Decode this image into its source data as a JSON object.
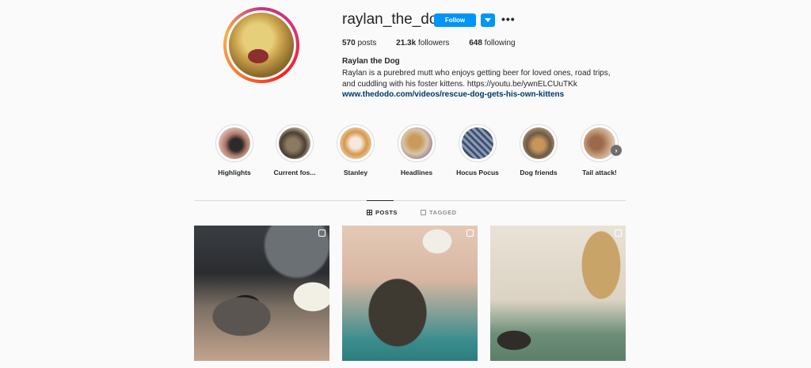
{
  "profile": {
    "username": "raylan_the_dog",
    "follow_label": "Follow",
    "more_glyph": "•••",
    "stats": {
      "posts_count": "570",
      "posts_label": "posts",
      "followers_count": "21.3k",
      "followers_label": "followers",
      "following_count": "648",
      "following_label": "following"
    },
    "full_name": "Raylan the Dog",
    "bio": "Raylan is a purebred mutt who enjoys getting beer for loved ones, road trips, and cuddling with his foster kittens. https://youtu.be/ywnELCUuTKk",
    "link": "www.thedodo.com/videos/rescue-dog-gets-his-own-kittens"
  },
  "highlights": [
    {
      "label": "Highlights"
    },
    {
      "label": "Current fos..."
    },
    {
      "label": "Stanley"
    },
    {
      "label": "Headlines"
    },
    {
      "label": "Hocus Pocus"
    },
    {
      "label": "Dog friends"
    },
    {
      "label": "Tail attack!"
    }
  ],
  "highlights_next_glyph": "›",
  "tabs": {
    "posts_label": "POSTS",
    "tagged_label": "TAGGED"
  },
  "posts": [
    {
      "type": "carousel-icon"
    },
    {
      "type": "video-icon"
    },
    {
      "type": "carousel-icon"
    }
  ],
  "colors": {
    "accent": "#0095f6",
    "link": "#00376b",
    "background": "#fafafa"
  }
}
